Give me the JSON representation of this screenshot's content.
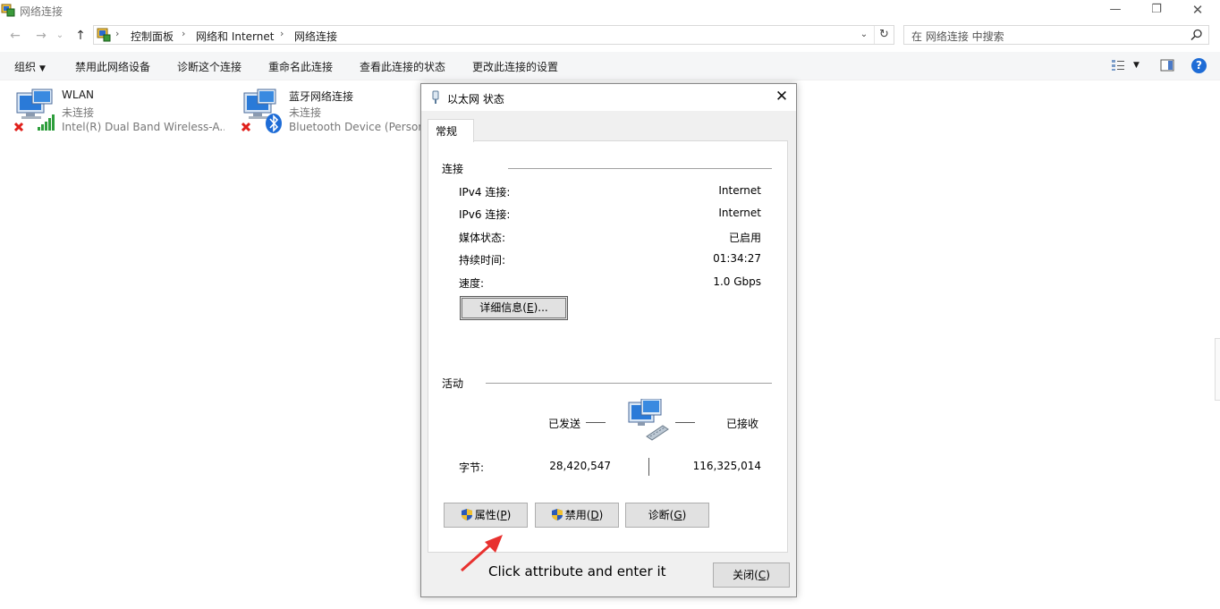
{
  "window": {
    "title": "网络连接",
    "minimize_glyph": "—",
    "maximize_glyph": "❐",
    "close_glyph": "✕"
  },
  "nav": {
    "back_glyph": "←",
    "forward_glyph": "→",
    "recent_glyph": "⌄",
    "up_glyph": "↑"
  },
  "address": {
    "root_sep": "›",
    "breadcrumbs": [
      "控制面板",
      "网络和 Internet",
      "网络连接"
    ],
    "separators": [
      "›",
      "›",
      "›"
    ],
    "dropdown_glyph": "⌄",
    "refresh_glyph": "↻"
  },
  "search": {
    "placeholder": "在 网络连接 中搜索"
  },
  "toolbar": {
    "organize": "组织",
    "organize_arrow": "▼",
    "commands": [
      "禁用此网络设备",
      "诊断这个连接",
      "重命名此连接",
      "查看此连接的状态",
      "更改此连接的设置"
    ],
    "view_arrow": "▼",
    "help": "?"
  },
  "connections": [
    {
      "name": "WLAN",
      "status": "未连接",
      "device": "Intel(R) Dual Band Wireless-A..."
    },
    {
      "name": "蓝牙网络连接",
      "status": "未连接",
      "device": "Bluetooth Device (Personal Area Network)"
    }
  ],
  "dialog": {
    "title": "以太网 状态",
    "close_glyph": "✕",
    "tab": "常规",
    "connection_group": "连接",
    "rows": [
      {
        "label": "IPv4 连接:",
        "value": "Internet"
      },
      {
        "label": "IPv6 连接:",
        "value": "Internet"
      },
      {
        "label": "媒体状态:",
        "value": "已启用"
      },
      {
        "label": "持续时间:",
        "value": "01:34:27"
      },
      {
        "label": "速度:",
        "value": "1.0 Gbps"
      }
    ],
    "details_button": {
      "text": "详细信息(",
      "key": "E",
      "suffix": ")..."
    },
    "activity_group": "活动",
    "sent_label": "已发送",
    "received_label": "已接收",
    "bytes_label": "字节:",
    "bytes_sent": "28,420,547",
    "bytes_received": "116,325,014",
    "properties_button": {
      "text": "属性(",
      "key": "P",
      "suffix": ")"
    },
    "disable_button": {
      "text": "禁用(",
      "key": "D",
      "suffix": ")"
    },
    "diagnose_button": {
      "text": "诊断(",
      "key": "G",
      "suffix": ")"
    },
    "close_button": {
      "text": "关闭(",
      "key": "C",
      "suffix": ")"
    }
  },
  "annotation": {
    "text": "Click attribute and enter it",
    "arrow_color": "#e8312f"
  },
  "colors": {
    "accent": "#1e6cd6",
    "error_red": "#e0201b",
    "signal_green": "#2e9e3c"
  }
}
